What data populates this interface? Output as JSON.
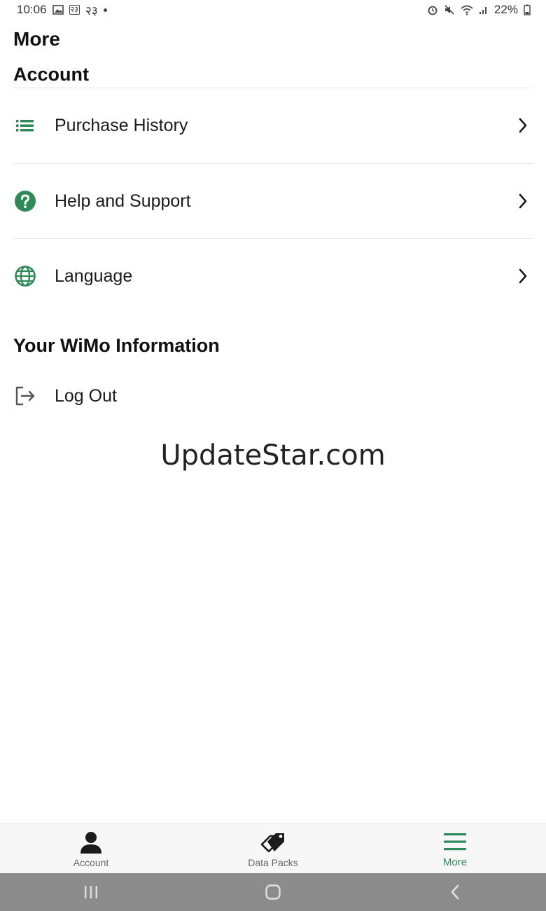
{
  "status_bar": {
    "time": "10:06",
    "badge": "२३",
    "badge_text": "२३",
    "battery": "22%"
  },
  "header": {
    "title": "More"
  },
  "sections": {
    "account": {
      "title": "Account",
      "items": [
        {
          "label": "Purchase History",
          "icon": "list-icon"
        },
        {
          "label": "Help and Support",
          "icon": "help-circle-icon"
        },
        {
          "label": "Language",
          "icon": "globe-icon"
        }
      ]
    },
    "wimo": {
      "title": "Your WiMo Information",
      "items": [
        {
          "label": "Log Out",
          "icon": "logout-icon"
        }
      ]
    }
  },
  "watermark": "UpdateStar.com",
  "bottom_nav": {
    "items": [
      {
        "label": "Account",
        "icon": "person-icon",
        "active": false
      },
      {
        "label": "Data Packs",
        "icon": "tags-icon",
        "active": false
      },
      {
        "label": "More",
        "icon": "menu-icon",
        "active": true
      }
    ]
  },
  "colors": {
    "accent": "#2e8b57",
    "text": "#1b1b1b",
    "nav_bg": "#f7f7f7",
    "system_nav_bg": "#8c8c8c"
  }
}
